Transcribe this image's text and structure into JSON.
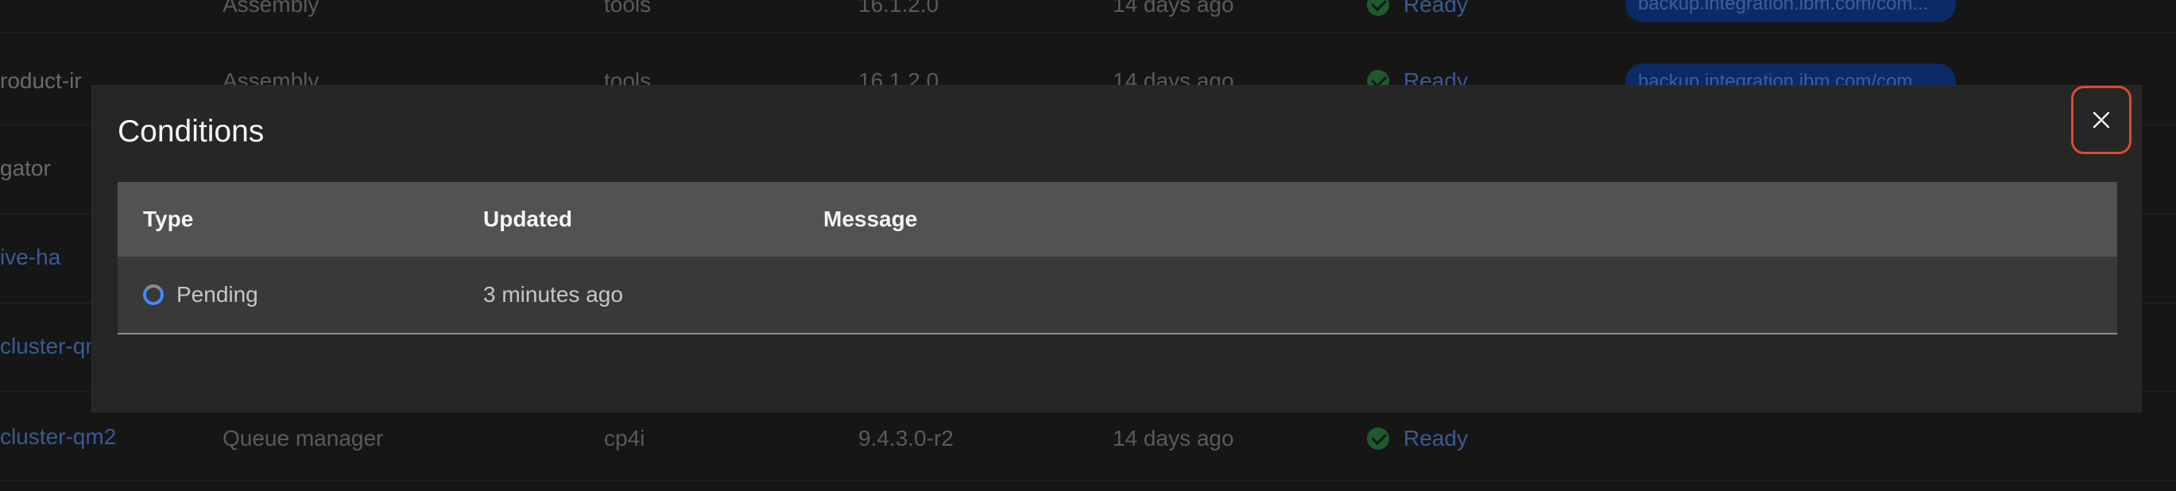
{
  "background_table": {
    "rows": [
      {
        "name": "",
        "kind": "Assembly",
        "namespace": "tools",
        "version": "16.1.2.0",
        "age": "14 days ago",
        "status": "Ready",
        "tag": "backup.integration.ibm.com/com..."
      },
      {
        "name": "roduct-ir",
        "kind": "Assembly",
        "namespace": "tools",
        "version": "16.1.2.0",
        "age": "14 days ago",
        "status": "Ready",
        "tag": "backup.integration.ibm.com/com..."
      },
      {
        "name": "gator",
        "kind": "",
        "namespace": "",
        "version": "",
        "age": "",
        "status": "",
        "tag": ""
      },
      {
        "name": "ive-ha",
        "kind": "",
        "namespace": "",
        "version": "",
        "age": "",
        "status": "",
        "tag": ""
      },
      {
        "name": "cluster-qm",
        "kind": "",
        "namespace": "",
        "version": "",
        "age": "",
        "status": "",
        "tag": ""
      },
      {
        "name": "cluster-qm2",
        "kind": "Queue manager",
        "namespace": "cp4i",
        "version": "9.4.3.0-r2",
        "age": "14 days ago",
        "status": "Ready",
        "tag": ""
      }
    ]
  },
  "modal": {
    "title": "Conditions",
    "close_icon": "close-icon",
    "table": {
      "headers": {
        "type": "Type",
        "updated": "Updated",
        "message": "Message"
      },
      "rows": [
        {
          "type": "Pending",
          "updated": "3 minutes ago",
          "message": "",
          "status_icon": "pending-spinner-icon"
        }
      ]
    }
  },
  "colors": {
    "accent": "#4589ff",
    "close_highlight": "#e0492b",
    "ready_check": "#24a148"
  }
}
